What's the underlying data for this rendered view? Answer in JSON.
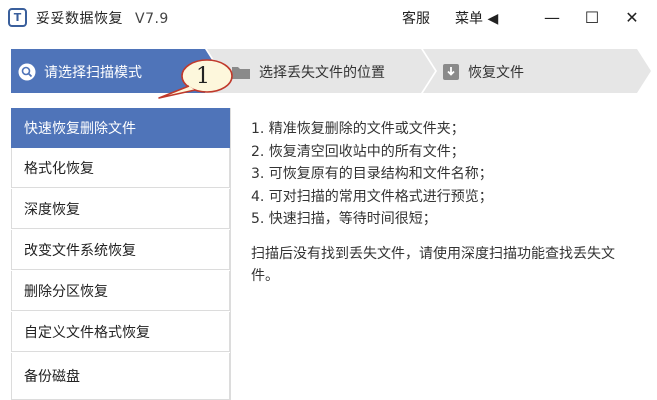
{
  "titlebar": {
    "logo_glyph": "T",
    "title": "妥妥数据恢复",
    "version": "V7.9",
    "service_label": "客服",
    "menu_label": "菜单 ◀",
    "minimize_glyph": "—",
    "maximize_glyph": "☐",
    "close_glyph": "✕"
  },
  "steps": [
    {
      "label": "请选择扫描模式",
      "icon": "search-icon"
    },
    {
      "label": "选择丢失文件的位置",
      "icon": "folder-icon"
    },
    {
      "label": "恢复文件",
      "icon": "download-icon"
    }
  ],
  "callout": {
    "number": "1"
  },
  "sidebar": {
    "items": [
      {
        "label": "快速恢复删除文件"
      },
      {
        "label": "格式化恢复"
      },
      {
        "label": "深度恢复"
      },
      {
        "label": "改变文件系统恢复"
      },
      {
        "label": "删除分区恢复"
      },
      {
        "label": "自定义文件格式恢复"
      },
      {
        "label": "备份磁盘"
      }
    ]
  },
  "content": {
    "features": [
      "1. 精准恢复删除的文件或文件夹；",
      "2. 恢复清空回收站中的所有文件；",
      "3. 可恢复原有的目录结构和文件名称；",
      "4. 可对扫描的常用文件格式进行预览；",
      "5. 快速扫描，等待时间很短；"
    ],
    "note": "扫描后没有找到丢失文件，请使用深度扫描功能查找丢失文件。"
  },
  "colors": {
    "accent": "#4f74b9",
    "step_inactive": "#e6e6e6"
  }
}
